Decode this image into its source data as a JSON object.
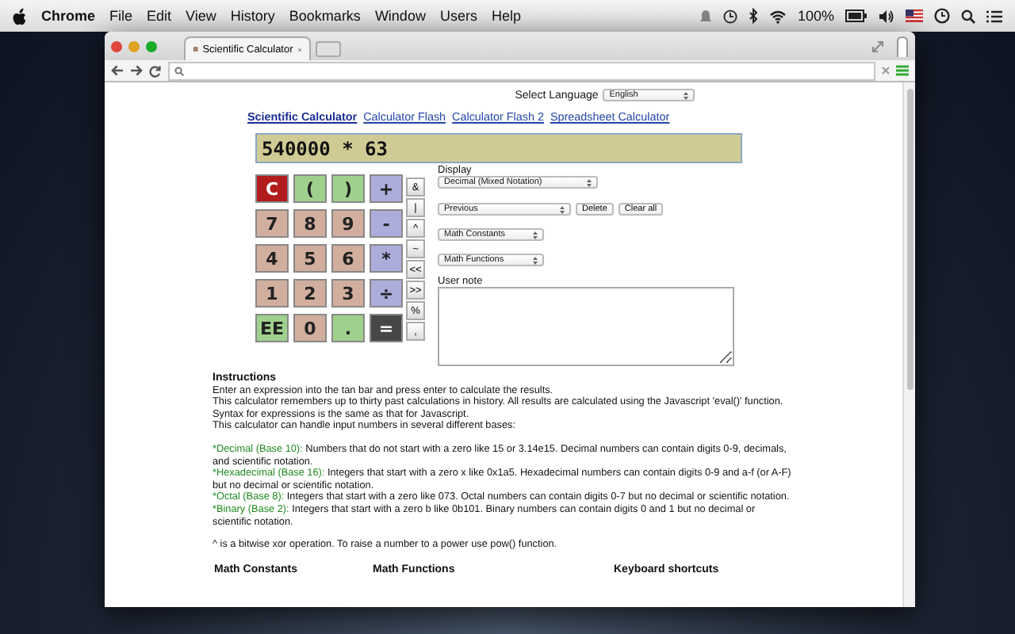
{
  "menu_bar": {
    "items": [
      "Chrome",
      "File",
      "Edit",
      "View",
      "History",
      "Bookmarks",
      "Window",
      "Users",
      "Help"
    ],
    "battery": "100%"
  },
  "browser": {
    "tab": {
      "title": "Scientific Calculator"
    }
  },
  "page": {
    "language": {
      "label": "Select Language",
      "value": "English"
    },
    "nav_links": [
      {
        "label": "Scientific Calculator",
        "selected": true
      },
      {
        "label": "Calculator Flash",
        "selected": false
      },
      {
        "label": "Calculator Flash 2",
        "selected": false
      },
      {
        "label": "Spreadsheet Calculator",
        "selected": false
      }
    ],
    "expression": "540000 * 63",
    "keys": [
      {
        "label": "C",
        "kind": "clear"
      },
      {
        "label": "(",
        "kind": "paren"
      },
      {
        "label": ")",
        "kind": "paren"
      },
      {
        "label": "+",
        "kind": "operator"
      },
      {
        "label": "7",
        "kind": "digit"
      },
      {
        "label": "8",
        "kind": "digit"
      },
      {
        "label": "9",
        "kind": "digit"
      },
      {
        "label": "-",
        "kind": "operator"
      },
      {
        "label": "4",
        "kind": "digit"
      },
      {
        "label": "5",
        "kind": "digit"
      },
      {
        "label": "6",
        "kind": "digit"
      },
      {
        "label": "*",
        "kind": "operator"
      },
      {
        "label": "1",
        "kind": "digit"
      },
      {
        "label": "2",
        "kind": "digit"
      },
      {
        "label": "3",
        "kind": "digit"
      },
      {
        "label": "÷",
        "kind": "operator"
      },
      {
        "label": "EE",
        "kind": "paren"
      },
      {
        "label": "0",
        "kind": "digit"
      },
      {
        "label": ".",
        "kind": "paren"
      },
      {
        "label": "=",
        "kind": "equals"
      }
    ],
    "small_keys": [
      "&",
      "|",
      "^",
      "~",
      "<<",
      ">>",
      "%",
      ","
    ],
    "display": {
      "label": "Display",
      "value": "Decimal (Mixed Notation)"
    },
    "history": {
      "value": "Previous",
      "buttons": [
        "Delete",
        "Clear all"
      ]
    },
    "constants": {
      "value": "Math Constants"
    },
    "functions": {
      "value": "Math Functions"
    },
    "user_note": {
      "label": "User note"
    },
    "instructions": {
      "heading": "Instructions",
      "lines": [
        "Enter an expression into the tan bar and press enter to calculate the results.",
        "This calculator remembers up to thirty past calculations in history. All results are calculated using the Javascript 'eval()' function. Syntax for expressions is the same as that for Javascript.",
        "This calculator can handle input numbers in several different bases:"
      ],
      "bases": [
        {
          "name": "*Decimal (Base 10):",
          "text": "Numbers that do not start with a zero like 15 or 3.14e15. Decimal numbers can contain digits 0-9, decimals, and scientific notation."
        },
        {
          "name": "*Hexadecimal (Base 16):",
          "text": "Integers that start with a zero x like 0x1a5. Hexadecimal numbers can contain digits 0-9 and a-f (or A-F) but no decimal or scientific notation."
        },
        {
          "name": "*Octal (Base 8):",
          "text": "Integers that start with a zero like 073. Octal numbers can contain digits 0-7 but no decimal or scientific notation."
        },
        {
          "name": "*Binary (Base 2):",
          "text": "Integers that start with a zero b like 0b101. Binary numbers can contain digits 0 and 1 but no decimal or scientific notation."
        }
      ],
      "note": "^ is a bitwise xor operation. To raise a number to a power use pow() function."
    },
    "sections": [
      "Math Constants",
      "Math Functions",
      "Keyboard shortcuts"
    ]
  }
}
